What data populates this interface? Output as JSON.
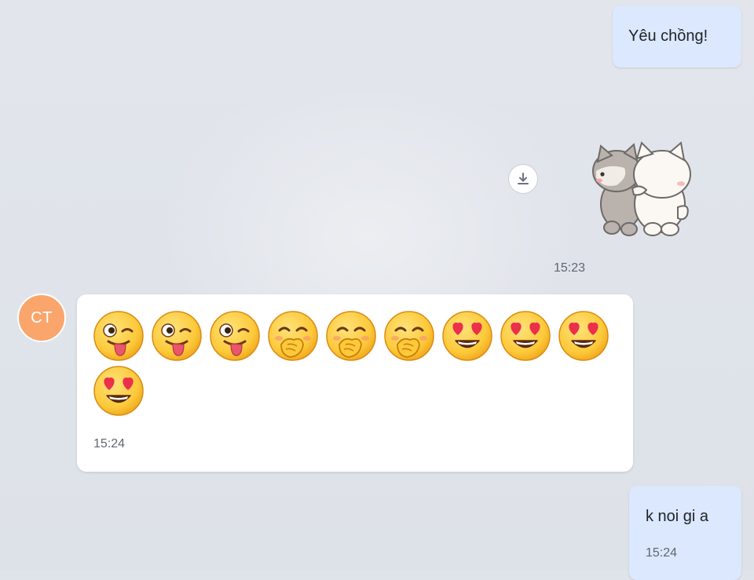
{
  "messages": {
    "outgoing_text_1": "Yêu chồng!",
    "sticker": {
      "icon": "hugging-cats-sticker",
      "download_icon": "download-icon",
      "time": "15:23"
    },
    "incoming_emoji_message": {
      "sender_initials": "CT",
      "emojis": [
        "winking-tongue-face",
        "winking-tongue-face",
        "winking-tongue-face",
        "hand-over-mouth-face",
        "hand-over-mouth-face",
        "hand-over-mouth-face",
        "heart-eyes-face",
        "heart-eyes-face",
        "heart-eyes-face",
        "heart-eyes-face"
      ],
      "time": "15:24"
    },
    "outgoing_text_2": {
      "text": "k noi gi a",
      "time": "15:24"
    }
  },
  "colors": {
    "outgoing_bubble": "#dbe8fd",
    "incoming_bubble": "#ffffff",
    "avatar": "#f9a56b",
    "chat_background": "#dfe3ea"
  }
}
